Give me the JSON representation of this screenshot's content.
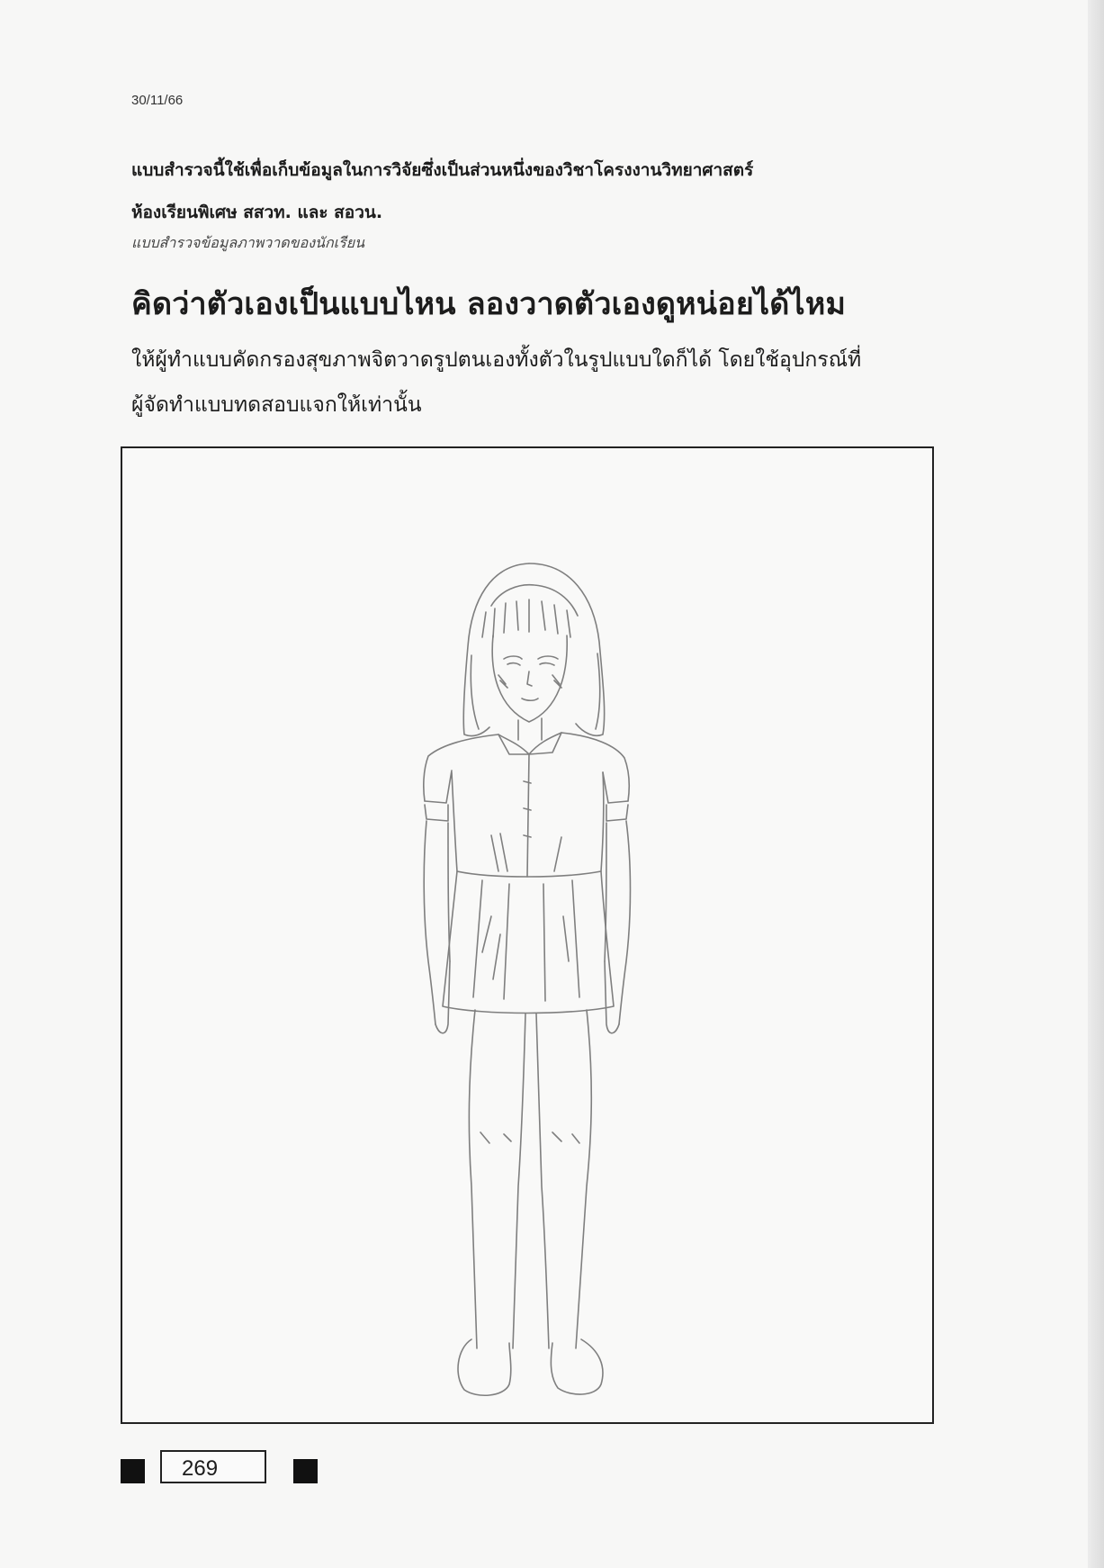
{
  "header": {
    "date": "30/11/66"
  },
  "intro": {
    "line1": "แบบสำรวจนี้ใช้เพื่อเก็บข้อมูลในการวิจัยซึ่งเป็นส่วนหนึ่งของวิชาโครงงานวิทยาศาสตร์",
    "line2": "ห้องเรียนพิเศษ สสวท. และ สอวน.",
    "subtitle": "แบบสำรวจข้อมูลภาพวาดของนักเรียน"
  },
  "question": {
    "title": "คิดว่าตัวเองเป็นแบบไหน ลองวาดตัวเองดูหน่อยได้ไหม",
    "instruction_line1": "ให้ผู้ทำแบบคัดกรองสุขภาพจิตวาดรูปตนเองทั้งตัวในรูปแบบใดก็ได้ โดยใช้อุปกรณ์ที่",
    "instruction_line2": "ผู้จัดทำแบบทดสอบแจกให้เท่านั้น"
  },
  "footer": {
    "id_number": "269"
  },
  "colors": {
    "ink": "#1c1c1c",
    "pencil": "#6a6a6a",
    "paper": "#f7f7f6"
  }
}
